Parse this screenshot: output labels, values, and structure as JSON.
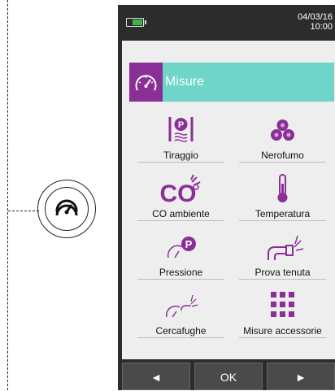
{
  "status": {
    "date": "04/03/16",
    "time": "10:00"
  },
  "header": {
    "title": "Misure"
  },
  "tiles": [
    {
      "label": "Tiraggio"
    },
    {
      "label": "Nerofumo"
    },
    {
      "label": "CO ambiente"
    },
    {
      "label": "Temperatura"
    },
    {
      "label": "Pressione"
    },
    {
      "label": "Prova tenuta"
    },
    {
      "label": "Cercafughe"
    },
    {
      "label": "Misure accessorie"
    }
  ],
  "buttons": {
    "left": "◄",
    "ok": "OK",
    "right": "►"
  },
  "colors": {
    "accent_purple": "#8a2f96",
    "header_teal": "#6ed5c8",
    "device_body": "#2c2c2c",
    "screen_bg": "#eeeeee"
  }
}
